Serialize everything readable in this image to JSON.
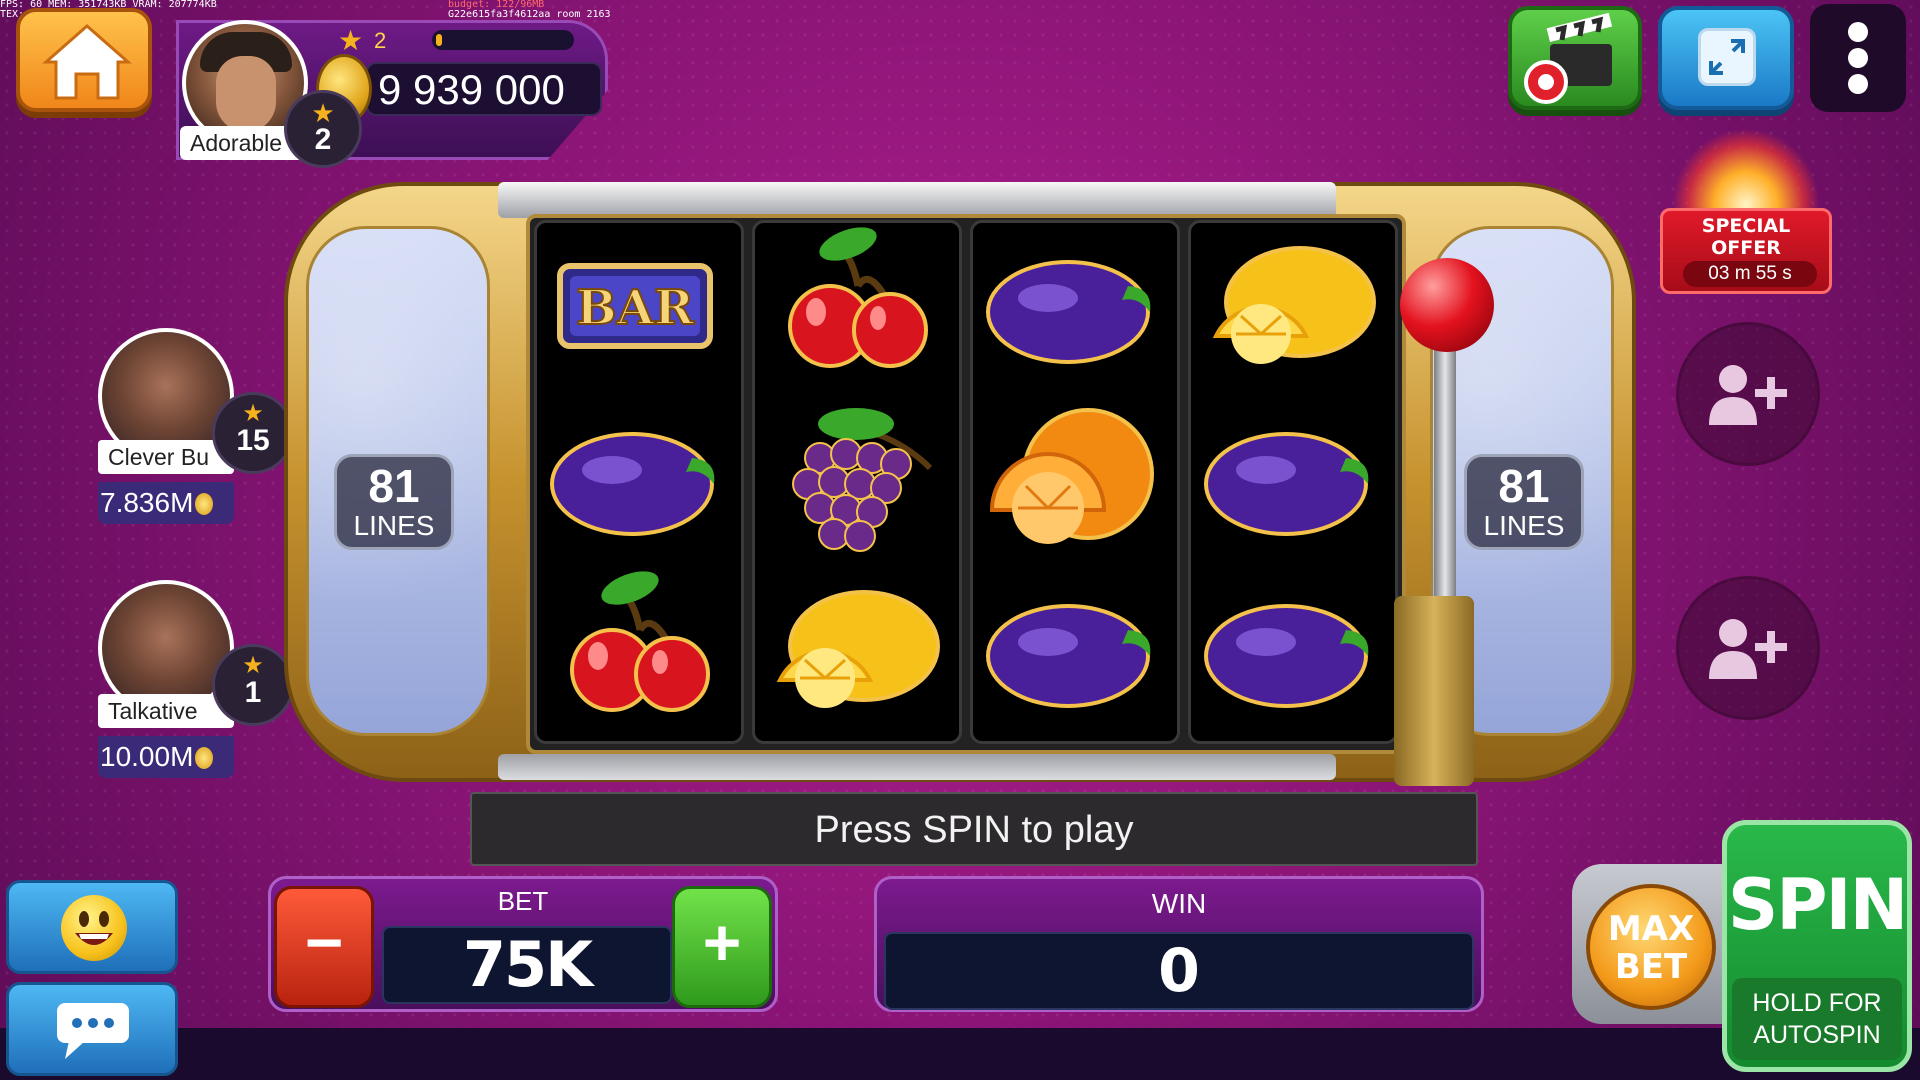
{
  "debug": {
    "line1": "FPS: 60     MEM: 351743KB     VRAM: 207774KB",
    "budget": "budget: 122/96MB",
    "line2": "TEX: 4015332KB",
    "hash": "G22e615fa3f4612aa room 2163"
  },
  "player": {
    "name": "Adorable",
    "level": "2",
    "xp_level": "2",
    "xp_progress": 0.03,
    "coins": "9 939 000"
  },
  "special_offer": {
    "line1": "SPECIAL",
    "line2": "OFFER",
    "timer": "03 m  55 s"
  },
  "other_players": [
    {
      "name": "Clever Bu",
      "level": "15",
      "coins": "7.836M"
    },
    {
      "name": "Talkative",
      "level": "1",
      "coins": "10.00M"
    }
  ],
  "machine": {
    "lines_left": {
      "number": "81",
      "label": "LINES"
    },
    "lines_right": {
      "number": "81",
      "label": "LINES"
    },
    "bar_symbol_text": "BAR",
    "reels": [
      [
        "bar",
        "plum",
        "cherry"
      ],
      [
        "cherry",
        "grapes",
        "lemon"
      ],
      [
        "plum",
        "orange",
        "plum"
      ],
      [
        "lemon",
        "plum",
        "plum"
      ]
    ]
  },
  "message": "Press SPIN to play",
  "controls": {
    "bet_label": "BET",
    "bet_value": "75K",
    "minus": "−",
    "plus": "+",
    "win_label": "WIN",
    "win_value": "0",
    "max_bet_1": "MAX",
    "max_bet_2": "BET",
    "spin": "SPIN",
    "spin_sub_1": "HOLD FOR",
    "spin_sub_2": "AUTOSPIN"
  },
  "icons": [
    "home-icon",
    "video-clapper-icon",
    "fullscreen-icon",
    "more-vert-icon",
    "add-friend-icon",
    "emoji-icon",
    "chat-icon",
    "star-icon",
    "coin-icon"
  ],
  "colors": {
    "background": "#8d1578",
    "spin_green": "#2ab84a",
    "bet_minus": "#e23a1f",
    "bet_plus": "#4cc233",
    "offer_red": "#e0192a"
  }
}
